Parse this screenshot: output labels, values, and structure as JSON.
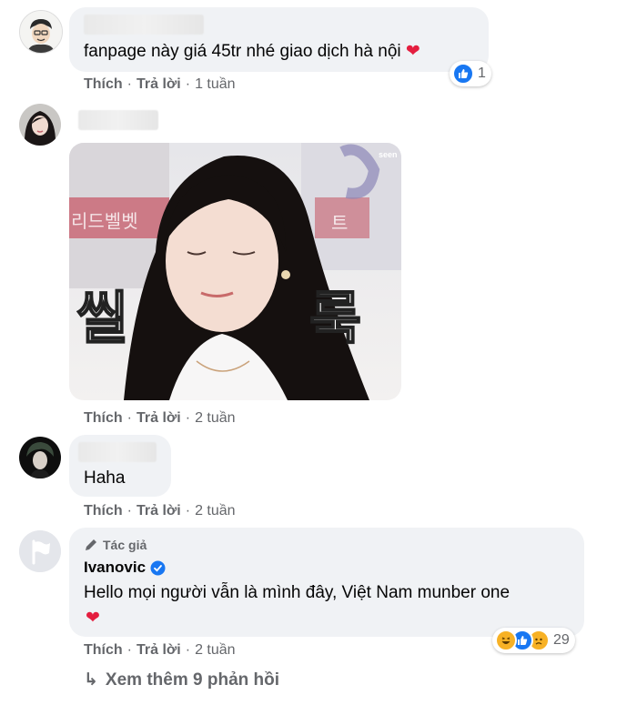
{
  "colors": {
    "like_blue": "#1877f2",
    "heart_red": "#f33e58",
    "secondary": "#65676b",
    "bubble": "#f0f2f5"
  },
  "comments": [
    {
      "text": "fanpage này giá 45tr nhé giao dịch hà nội",
      "emoji": "❤️",
      "time": "1 tuần",
      "reaction_count": "1",
      "reactions": [
        "like-icon"
      ]
    },
    {
      "time": "2 tuần",
      "sticker_text": [
        "씰",
        "룩"
      ],
      "sticker_logo": "seen",
      "sticker_sign": [
        "리드벨벳",
        "트"
      ]
    },
    {
      "text": "Haha",
      "time": "2 tuần"
    },
    {
      "author_badge": "Tác giả",
      "author": "Ivanovic",
      "text": "Hello mọi người vẫn là mình đây, Việt Nam munber one",
      "emoji": "❤️",
      "time": "2 tuần",
      "reaction_count": "29",
      "reactions": [
        "haha-icon",
        "like-icon",
        "sad-icon"
      ]
    }
  ],
  "actions": {
    "like": "Thích",
    "reply": "Trả lời",
    "sep": "·"
  },
  "more_replies": {
    "arrow": "↳",
    "label": "Xem thêm 9 phản hồi"
  }
}
